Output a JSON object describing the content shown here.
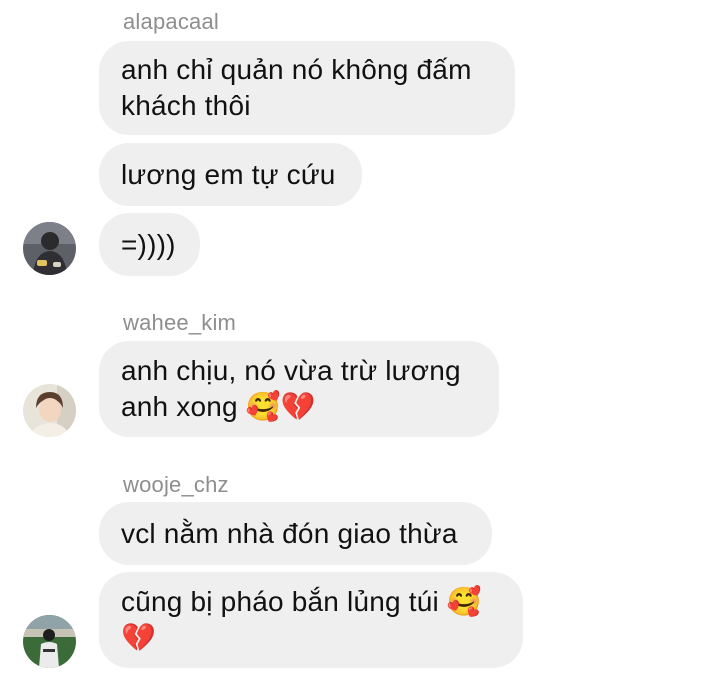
{
  "conversation": {
    "groups": [
      {
        "sender": "alapacaal",
        "messages": [
          "anh chỉ quản nó không đấm\nkhách thôi",
          "lương em tự cứu",
          "=))))"
        ]
      },
      {
        "sender": "wahee_kim",
        "messages": [
          "anh chịu, nó vừa trừ lương\nanh xong 🥰💔"
        ]
      },
      {
        "sender": "wooje_chz",
        "messages": [
          "vcl nằm nhà đón giao thừa",
          "cũng bị pháo bắn lủng túi 🥰\n💔"
        ]
      }
    ]
  },
  "colors": {
    "bubble_bg": "#efefef",
    "sender_text": "#8e8e8e",
    "message_text": "#111111"
  }
}
